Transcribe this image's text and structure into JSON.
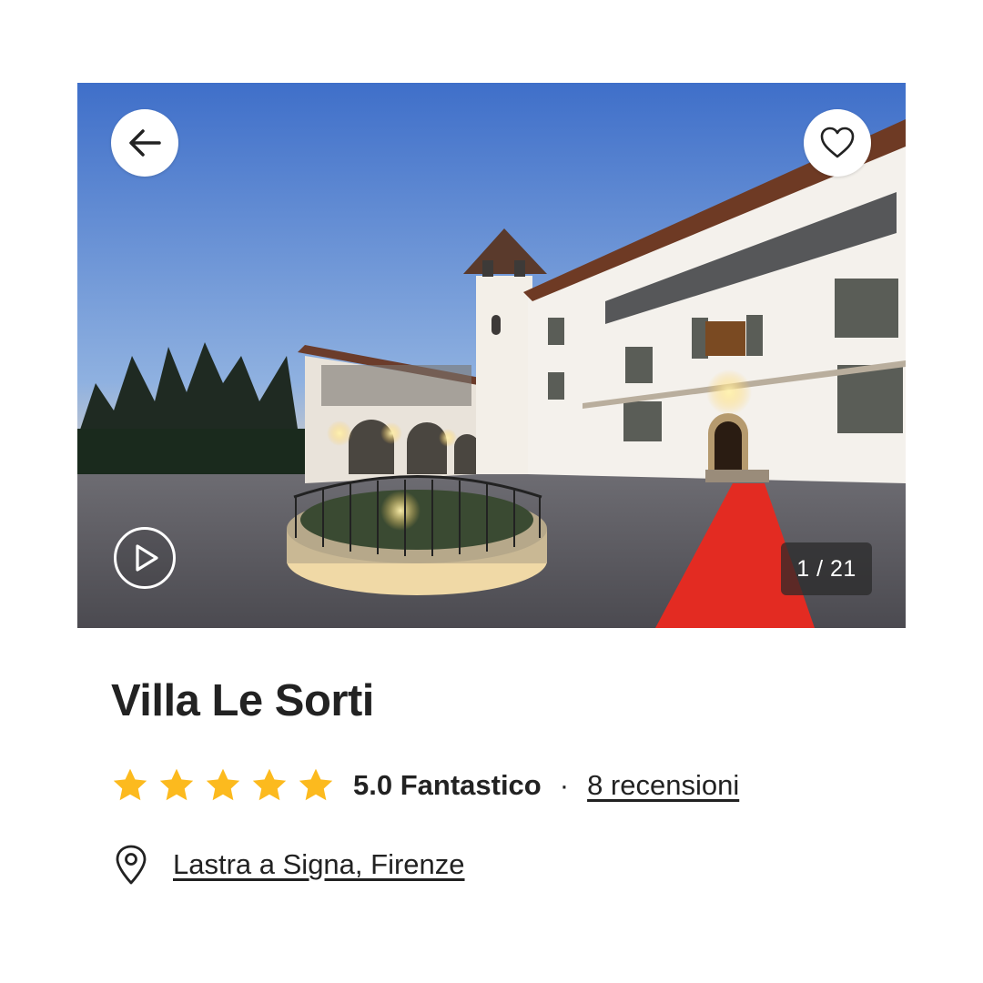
{
  "gallery": {
    "counter": "1 / 21",
    "back_icon": "arrow-left-icon",
    "favorite_icon": "heart-icon",
    "play_icon": "play-icon"
  },
  "venue": {
    "name": "Villa Le Sorti",
    "rating": {
      "stars": 5,
      "max_stars": 5,
      "score_label": "5.0 Fantastico",
      "separator": "·",
      "reviews_label": "8 recensioni"
    },
    "location": "Lastra a Signa, Firenze",
    "location_icon": "map-pin-icon"
  },
  "colors": {
    "star": "#FCBA1E",
    "text": "#222222",
    "carpet": "#E32B22"
  }
}
